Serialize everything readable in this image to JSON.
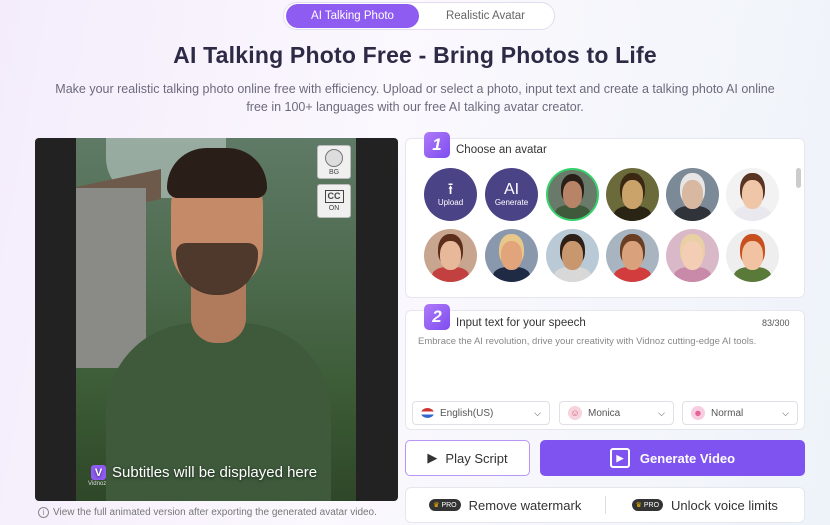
{
  "tabs": [
    {
      "label": "AI Talking Photo",
      "active": true
    },
    {
      "label": "Realistic Avatar",
      "active": false
    }
  ],
  "headline": "AI Talking Photo Free - Bring Photos to Life",
  "description": "Make your realistic talking photo online free with efficiency. Upload or select a photo, input text and create a talking photo AI online free in 100+ languages with our free AI talking avatar creator.",
  "preview": {
    "bg_label": "BG",
    "cc_label": "CC",
    "cc_state": "ON",
    "subtitle": "Subtitles will be displayed here",
    "watermark": "Vidnoz",
    "logo_letter": "V",
    "note": "View the full animated version after exporting the generated avatar video."
  },
  "step1": {
    "number": "1",
    "title": "Choose an avatar",
    "upload_label": "Upload",
    "ai_label": "AI",
    "generate_label": "Generate",
    "avatars": [
      {
        "name": "avatar-man-green-shirt",
        "skin": "#b88468",
        "hair": "#2a1e18",
        "bg": "#6a7a6a",
        "shirt": "#3e5a3b",
        "selected": true
      },
      {
        "name": "avatar-mona-lisa",
        "skin": "#c9a36a",
        "hair": "#3a2812",
        "bg": "#6a6a3a",
        "shirt": "#2a2414",
        "selected": false
      },
      {
        "name": "avatar-einstein",
        "skin": "#d8b8a0",
        "hair": "#e6e6e6",
        "bg": "#7b8a96",
        "shirt": "#30333a",
        "selected": false
      },
      {
        "name": "avatar-cartoon-boy",
        "skin": "#f0c6a8",
        "hair": "#5a3422",
        "bg": "#f2f2f2",
        "shirt": "#e8e8ee",
        "selected": false
      },
      {
        "name": "avatar-cartoon-girl-brown",
        "skin": "#e7b99a",
        "hair": "#5e2e1c",
        "bg": "#c8a58f",
        "shirt": "#c24040",
        "selected": false
      },
      {
        "name": "avatar-trump",
        "skin": "#e2a47a",
        "hair": "#e8c88a",
        "bg": "#8a98ad",
        "shirt": "#1f2a44",
        "selected": false
      },
      {
        "name": "avatar-ronaldo",
        "skin": "#c9976e",
        "hair": "#2e2016",
        "bg": "#b9c9d6",
        "shirt": "#d8d8d8",
        "selected": false
      },
      {
        "name": "avatar-messi",
        "skin": "#d9a27c",
        "hair": "#6a3e22",
        "bg": "#a8b5c0",
        "shirt": "#d23c3c",
        "selected": false
      },
      {
        "name": "avatar-cartoon-blonde",
        "skin": "#f3cdb4",
        "hair": "#e8cfa4",
        "bg": "#d9b8c8",
        "shirt": "#c88aa8",
        "selected": false
      },
      {
        "name": "avatar-cartoon-redhead",
        "skin": "#f2c3a2",
        "hair": "#c8501e",
        "bg": "#eeeeee",
        "shirt": "#5a7a3a",
        "selected": false
      }
    ]
  },
  "step2": {
    "number": "2",
    "title": "Input text for your speech",
    "counter": "83/300",
    "speech_text": "Embrace the AI revolution, drive your creativity with Vidnoz cutting-edge AI tools.",
    "language": "English(US)",
    "voice": "Monica",
    "emotion": "Normal"
  },
  "actions": {
    "play_label": "Play Script",
    "generate_label": "Generate Video",
    "pro_badge": "PRO",
    "remove_watermark": "Remove watermark",
    "unlock_voice": "Unlock voice limits"
  },
  "colors": {
    "accent": "#7f53ef",
    "tab_active": "#8e5cf0",
    "selected_ring": "#35d16b"
  }
}
